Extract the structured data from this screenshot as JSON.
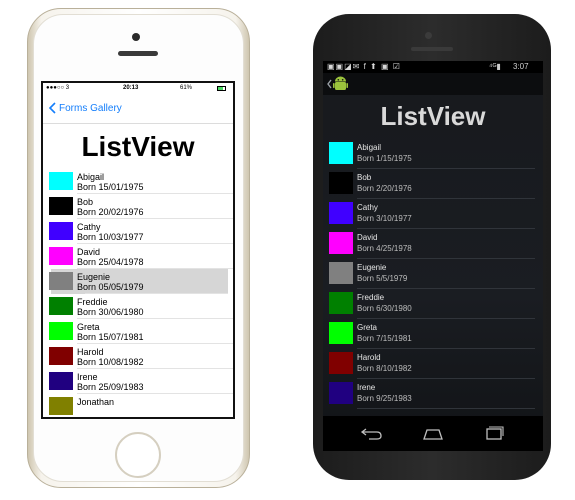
{
  "ios": {
    "status": {
      "signal": "●●●○○ 3",
      "time": "20:13",
      "battery_pct": "61%"
    },
    "back_label": "Forms Gallery",
    "title": "ListView",
    "items": [
      {
        "name": "Abigail",
        "born": "Born 15/01/1975",
        "color": "#00ffff"
      },
      {
        "name": "Bob",
        "born": "Born 20/02/1976",
        "color": "#000000"
      },
      {
        "name": "Cathy",
        "born": "Born 10/03/1977",
        "color": "#4000ff"
      },
      {
        "name": "David",
        "born": "Born 25/04/1978",
        "color": "#ff00ff"
      },
      {
        "name": "Eugenie",
        "born": "Born 05/05/1979",
        "color": "#808080"
      },
      {
        "name": "Freddie",
        "born": "Born 30/06/1980",
        "color": "#008000"
      },
      {
        "name": "Greta",
        "born": "Born 15/07/1981",
        "color": "#00ff00"
      },
      {
        "name": "Harold",
        "born": "Born 10/08/1982",
        "color": "#800000"
      },
      {
        "name": "Irene",
        "born": "Born 25/09/1983",
        "color": "#200080"
      },
      {
        "name": "Jonathan",
        "born": "",
        "color": "#808000"
      }
    ],
    "selected_item": "Eugenie"
  },
  "android": {
    "status": {
      "time": "3:07",
      "signal": "⁴ᴳ▮"
    },
    "title": "ListView",
    "items": [
      {
        "name": "Abigail",
        "born": "Born 1/15/1975",
        "color": "#00ffff"
      },
      {
        "name": "Bob",
        "born": "Born 2/20/1976",
        "color": "#000000"
      },
      {
        "name": "Cathy",
        "born": "Born 3/10/1977",
        "color": "#4000ff"
      },
      {
        "name": "David",
        "born": "Born 4/25/1978",
        "color": "#ff00ff"
      },
      {
        "name": "Eugenie",
        "born": "Born 5/5/1979",
        "color": "#808080"
      },
      {
        "name": "Freddie",
        "born": "Born 6/30/1980",
        "color": "#008000"
      },
      {
        "name": "Greta",
        "born": "Born 7/15/1981",
        "color": "#00ff00"
      },
      {
        "name": "Harold",
        "born": "Born 8/10/1982",
        "color": "#800000"
      },
      {
        "name": "Irene",
        "born": "Born 9/25/1983",
        "color": "#200080"
      }
    ],
    "nav_icons": [
      "back-icon",
      "home-icon",
      "recents-icon"
    ]
  },
  "colors": {
    "ios_accent": "#147efb",
    "selection": "#d6d6d6"
  }
}
